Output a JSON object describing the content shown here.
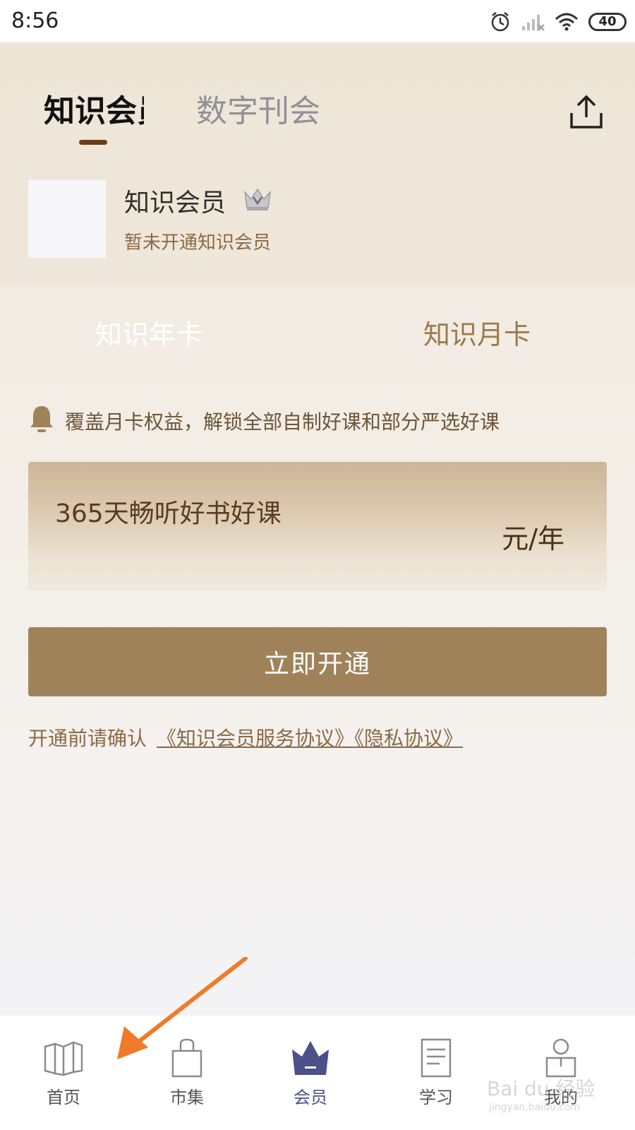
{
  "status_bar": {
    "time": "8:56",
    "battery": "40"
  },
  "tabs": [
    {
      "label": "知识会员",
      "active": true
    },
    {
      "label": "数字刊会",
      "active": false
    }
  ],
  "member": {
    "title": "知识会员",
    "subtitle": "暂未开通知识会员"
  },
  "plans": [
    {
      "label": "知识年卡",
      "selected": true
    },
    {
      "label": "知识月卡",
      "selected": false
    }
  ],
  "notice": {
    "text": "覆盖月卡权益，解锁全部自制好课和部分严选好课"
  },
  "price_card": {
    "description": "365天畅听好书好课",
    "unit": "元/年"
  },
  "cta": {
    "label": "立即开通"
  },
  "agreement": {
    "prefix": "开通前请确认",
    "links": "《知识会员服务协议》《隐私协议》"
  },
  "bottom_nav": [
    {
      "label": "首页",
      "icon": "book-icon",
      "active": false
    },
    {
      "label": "市集",
      "icon": "bag-icon",
      "active": false
    },
    {
      "label": "会员",
      "icon": "crown-icon",
      "active": true
    },
    {
      "label": "学习",
      "icon": "document-icon",
      "active": false
    },
    {
      "label": "我的",
      "icon": "person-icon",
      "active": false
    }
  ],
  "watermark": {
    "main": "Bai du 经验",
    "sub": "jingyan.baidu.com"
  },
  "colors": {
    "accent_brown": "#a0825a",
    "nav_active": "#4b4f8a",
    "arrow": "#f07a2a"
  }
}
